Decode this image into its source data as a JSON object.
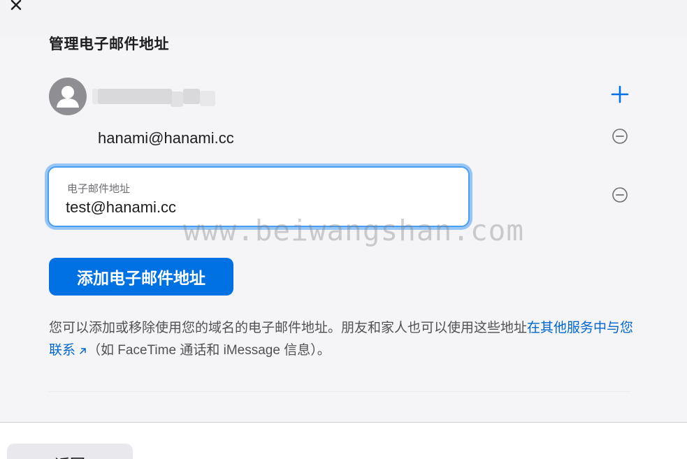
{
  "window": {
    "close_icon": "close-icon"
  },
  "section": {
    "title": "管理电子邮件地址"
  },
  "account": {
    "avatar_icon": "person-icon",
    "add_icon": "plus-icon"
  },
  "emails": [
    {
      "address": "hanami@hanami.cc",
      "remove_icon": "minus-circle-icon"
    }
  ],
  "new_email": {
    "label": "电子邮件地址",
    "value": "test@hanami.cc",
    "remove_icon": "minus-circle-icon"
  },
  "watermark": "www.beiwangshan.com",
  "add_button": {
    "label": "添加电子邮件地址"
  },
  "description": {
    "text": "您可以添加或移除使用您的域名的电子邮件地址。朋友和家人也可以使用这些地址",
    "link": "在其他服务中与您联系",
    "link_icon": "external-arrow-icon",
    "suffix": "（如 FaceTime 通话和 iMessage 信息）。"
  },
  "footer": {
    "back_label": "返回"
  },
  "colors": {
    "accent": "#0071e3",
    "link": "#0066cc",
    "focus_ring": "#4a9ef2",
    "avatar": "#8e8e93"
  }
}
